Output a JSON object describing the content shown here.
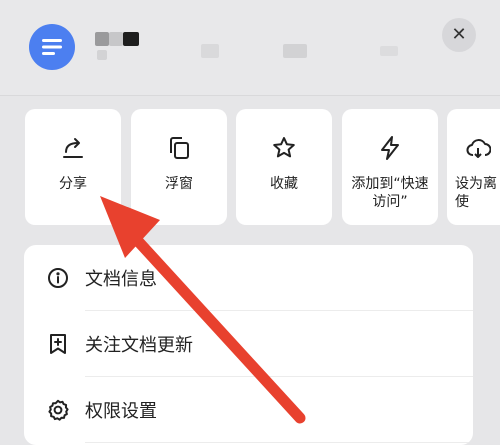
{
  "header": {
    "close_icon": "close-icon",
    "doc_icon": "document-lines-icon"
  },
  "actions": [
    {
      "label": "分享",
      "icon": "share-icon"
    },
    {
      "label": "浮窗",
      "icon": "floating-window-icon"
    },
    {
      "label": "收藏",
      "icon": "star-icon"
    },
    {
      "label": "添加到“快速\n访问”",
      "icon": "lightning-icon"
    },
    {
      "label": "设为离\n使",
      "icon": "cloud-icon"
    }
  ],
  "menu": [
    {
      "label": "文档信息",
      "icon": "info-icon"
    },
    {
      "label": "关注文档更新",
      "icon": "bookmark-plus-icon"
    },
    {
      "label": "权限设置",
      "icon": "gear-icon"
    }
  ],
  "annotation": {
    "color": "#e8412e"
  }
}
